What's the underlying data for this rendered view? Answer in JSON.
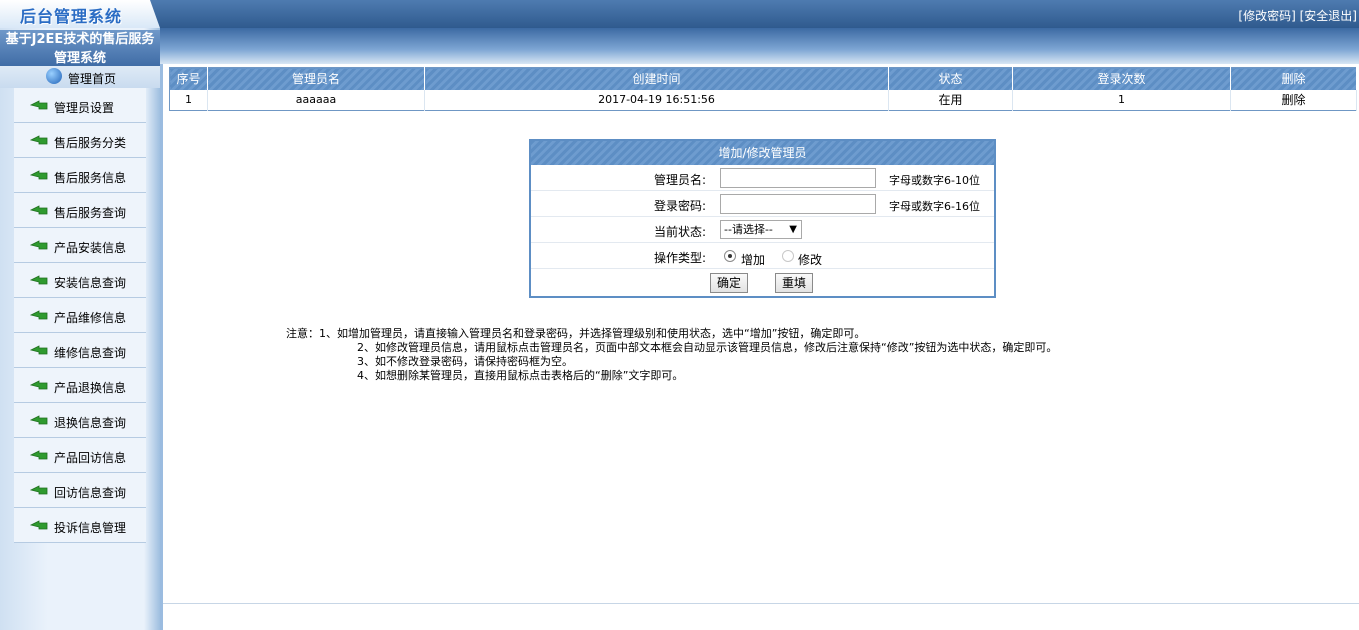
{
  "header": {
    "logo": "后台管理系统",
    "links": [
      "[修改密码]",
      "[安全退出]"
    ]
  },
  "sidebar": {
    "system_title": "基于J2EE技术的售后服务管理系统",
    "home_label": "管理首页",
    "items": [
      {
        "label": "管理员设置"
      },
      {
        "label": "售后服务分类"
      },
      {
        "label": "售后服务信息"
      },
      {
        "label": "售后服务查询"
      },
      {
        "label": "产品安装信息"
      },
      {
        "label": "安装信息查询"
      },
      {
        "label": "产品维修信息"
      },
      {
        "label": "维修信息查询"
      },
      {
        "label": "产品退换信息"
      },
      {
        "label": "退换信息查询"
      },
      {
        "label": "产品回访信息"
      },
      {
        "label": "回访信息查询"
      },
      {
        "label": "投诉信息管理"
      }
    ]
  },
  "table": {
    "headers": [
      "序号",
      "管理员名",
      "创建时间",
      "状态",
      "登录次数",
      "删除"
    ],
    "rows": [
      [
        "1",
        "aaaaaa",
        "2017-04-19 16:51:56",
        "在用",
        "1",
        "删除"
      ]
    ]
  },
  "form": {
    "title": "增加/修改管理员",
    "username_label": "管理员名:",
    "username_value": "",
    "username_hint": "字母或数字6-10位",
    "password_label": "登录密码:",
    "password_value": "",
    "password_hint": "字母或数字6-16位",
    "status_label": "当前状态:",
    "status_selected": "--请选择--",
    "optype_label": "操作类型:",
    "radio_add": "增加",
    "radio_edit": "修改",
    "submit": "确定",
    "reset": "重填"
  },
  "notes": {
    "line1": "注意：1、如增加管理员，请直接输入管理员名和登录密码，并选择管理级别和使用状态，选中“增加”按钮，确定即可。",
    "line2": "2、如修改管理员信息，请用鼠标点击管理员名，页面中部文本框会自动显示该管理员信息，修改后注意保持“修改”按钮为选中状态，确定即可。",
    "line3": "3、如不修改登录密码，请保持密码框为空。",
    "line4": "4、如想删除某管理员，直接用鼠标点击表格后的“删除”文字即可。"
  }
}
